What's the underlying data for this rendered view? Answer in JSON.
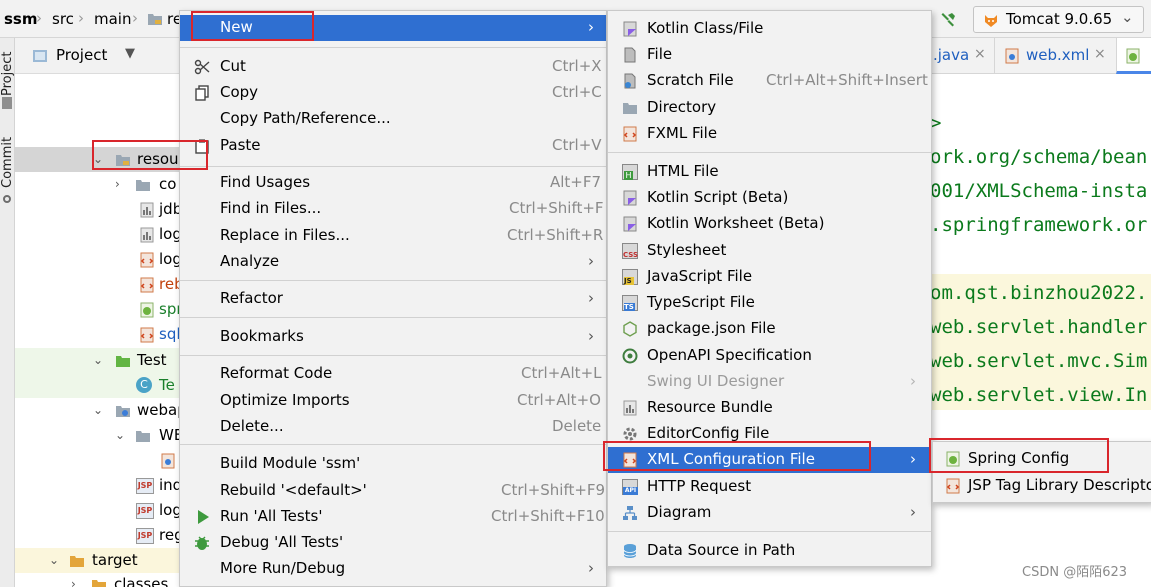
{
  "breadcrumb": [
    "ssm",
    "src",
    "main",
    "re"
  ],
  "run_config": {
    "label": "Tomcat 9.0.65"
  },
  "editor_tabs": [
    ".java",
    "web.xml"
  ],
  "side_stripe": [
    "Project",
    "Commit"
  ],
  "project_panel": {
    "title": "Project"
  },
  "tree": [
    {
      "label": "resou"
    },
    {
      "label": "co"
    },
    {
      "label": "jdb"
    },
    {
      "label": "log"
    },
    {
      "label": "log"
    },
    {
      "label": "reb"
    },
    {
      "label": "spr"
    },
    {
      "label": "sql"
    },
    {
      "label": "Test"
    },
    {
      "label": "Te"
    },
    {
      "label": "webap"
    },
    {
      "label": "WE"
    },
    {
      "label": "ind"
    },
    {
      "label": "log"
    },
    {
      "label": "reg"
    },
    {
      "label": "target"
    },
    {
      "label": "classes"
    }
  ],
  "context_menu": [
    {
      "label": "New",
      "shortcut": "",
      "submenu": true
    },
    {
      "label": "Cut",
      "shortcut": "Ctrl+X"
    },
    {
      "label": "Copy",
      "shortcut": "Ctrl+C"
    },
    {
      "label": "Copy Path/Reference...",
      "shortcut": ""
    },
    {
      "label": "Paste",
      "shortcut": "Ctrl+V"
    },
    {
      "label": "Find Usages",
      "shortcut": "Alt+F7"
    },
    {
      "label": "Find in Files...",
      "shortcut": "Ctrl+Shift+F"
    },
    {
      "label": "Replace in Files...",
      "shortcut": "Ctrl+Shift+R"
    },
    {
      "label": "Analyze",
      "shortcut": "",
      "submenu": true
    },
    {
      "label": "Refactor",
      "shortcut": "",
      "submenu": true
    },
    {
      "label": "Bookmarks",
      "shortcut": "",
      "submenu": true
    },
    {
      "label": "Reformat Code",
      "shortcut": "Ctrl+Alt+L"
    },
    {
      "label": "Optimize Imports",
      "shortcut": "Ctrl+Alt+O"
    },
    {
      "label": "Delete...",
      "shortcut": "Delete"
    },
    {
      "label": "Build Module 'ssm'",
      "shortcut": ""
    },
    {
      "label": "Rebuild '<default>'",
      "shortcut": "Ctrl+Shift+F9"
    },
    {
      "label": "Run 'All Tests'",
      "shortcut": "Ctrl+Shift+F10"
    },
    {
      "label": "Debug 'All Tests'",
      "shortcut": ""
    },
    {
      "label": "More Run/Debug",
      "shortcut": "",
      "submenu": true
    }
  ],
  "new_submenu": [
    {
      "label": "Kotlin Class/File",
      "shortcut": ""
    },
    {
      "label": "File",
      "shortcut": ""
    },
    {
      "label": "Scratch File",
      "shortcut": "Ctrl+Alt+Shift+Insert"
    },
    {
      "label": "Directory",
      "shortcut": ""
    },
    {
      "label": "FXML File",
      "shortcut": ""
    },
    {
      "label": "HTML File",
      "shortcut": ""
    },
    {
      "label": "Kotlin Script (Beta)",
      "shortcut": ""
    },
    {
      "label": "Kotlin Worksheet (Beta)",
      "shortcut": ""
    },
    {
      "label": "Stylesheet",
      "shortcut": ""
    },
    {
      "label": "JavaScript File",
      "shortcut": ""
    },
    {
      "label": "TypeScript File",
      "shortcut": ""
    },
    {
      "label": "package.json File",
      "shortcut": ""
    },
    {
      "label": "OpenAPI Specification",
      "shortcut": ""
    },
    {
      "label": "Swing UI Designer",
      "shortcut": "",
      "disabled": true,
      "submenu": true
    },
    {
      "label": "Resource Bundle",
      "shortcut": ""
    },
    {
      "label": "EditorConfig File",
      "shortcut": ""
    },
    {
      "label": "XML Configuration File",
      "shortcut": "",
      "submenu": true
    },
    {
      "label": "HTTP Request",
      "shortcut": ""
    },
    {
      "label": "Diagram",
      "shortcut": "",
      "submenu": true
    },
    {
      "label": "Data Source in Path",
      "shortcut": ""
    }
  ],
  "xml_submenu": [
    {
      "label": "Spring Config"
    },
    {
      "label": "JSP Tag Library Descriptor"
    }
  ],
  "code_lines": [
    ">",
    "ork.org/schema/bean",
    "001/XMLSchema-insta",
    ".springframework.or",
    "om.qst.binzhou2022.",
    "web.servlet.handler",
    "web.servlet.mvc.Sim",
    "web.servlet.view.In"
  ],
  "icon_labels": {
    "css": "CSS",
    "js": "JS",
    "ts": "TS",
    "api": "API",
    "jsp": "JSP",
    "html": "H",
    "test": "C"
  },
  "arrow": "›",
  "chevron_down": "⌄",
  "chevron_right": "›",
  "watermark": "CSDN @陌陌623",
  "colors": {
    "selection": "#2f6fd1",
    "annotation_box": "#d9262c",
    "code_text": "#0b7a1c",
    "menu_bg": "#f2f2f2"
  }
}
